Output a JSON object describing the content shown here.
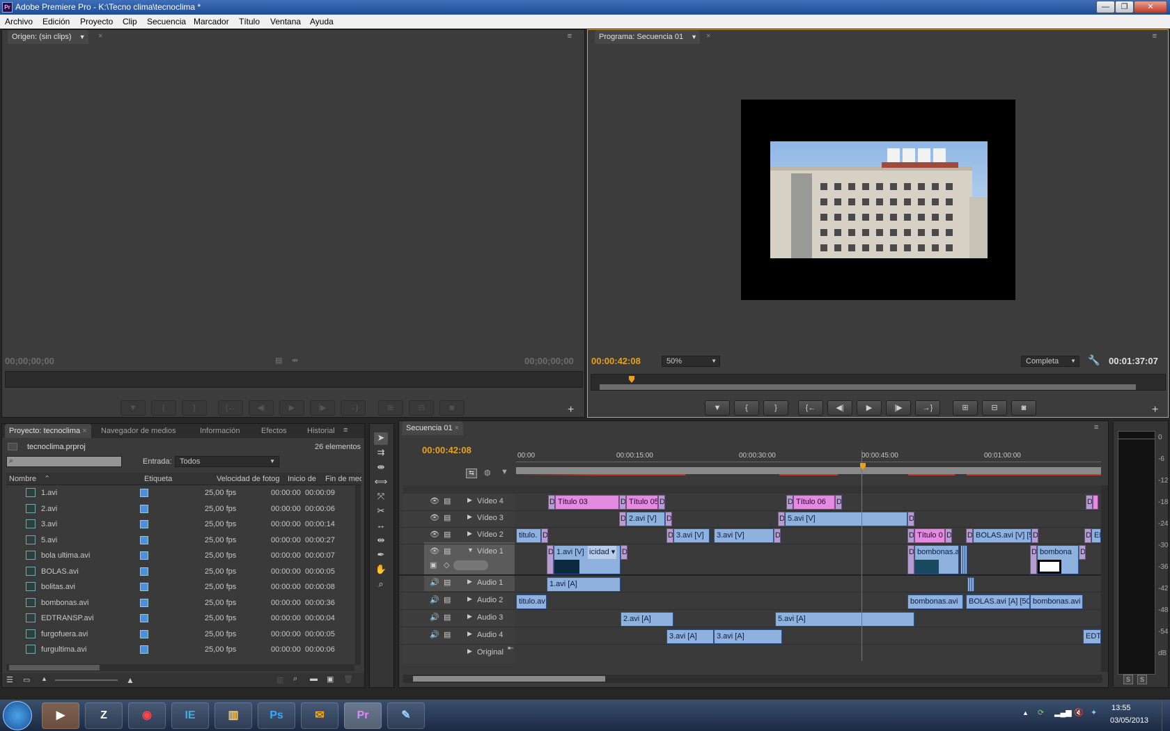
{
  "window": {
    "title": "Adobe Premiere Pro - K:\\Tecno clima\\tecnoclima *",
    "app_icon": "Pr",
    "buttons": {
      "minimize": "—",
      "restore": "❐",
      "close": "✕"
    }
  },
  "menu": [
    "Archivo",
    "Edición",
    "Proyecto",
    "Clip",
    "Secuencia",
    "Marcador",
    "Título",
    "Ventana",
    "Ayuda"
  ],
  "source": {
    "tab": "Origen: (sin clips)",
    "tc_left": "00;00;00;00",
    "tc_right": "00;00;00;00"
  },
  "program": {
    "tab": "Programa: Secuencia 01",
    "timecode": "00:00:42:08",
    "zoom": "50%",
    "quality": "Completa",
    "duration": "00:01:37:07"
  },
  "project": {
    "tabs": [
      "Proyecto: tecnoclima",
      "Navegador de medios",
      "Información",
      "Efectos",
      "Historial"
    ],
    "file": "tecnoclima.prproj",
    "count": "26 elementos",
    "entrada_label": "Entrada:",
    "entrada_value": "Todos",
    "search_placeholder": "",
    "columns": [
      "Nombre",
      "Etiqueta",
      "Velocidad de fotog",
      "Inicio de",
      "Fin de med"
    ],
    "rows": [
      {
        "name": "1.avi",
        "fps": "25,00 fps",
        "start": "00:00:00",
        "end": "00:00:09"
      },
      {
        "name": "2.avi",
        "fps": "25,00 fps",
        "start": "00:00:00",
        "end": "00:00:06"
      },
      {
        "name": "3.avi",
        "fps": "25,00 fps",
        "start": "00:00:00",
        "end": "00:00:14"
      },
      {
        "name": "5.avi",
        "fps": "25,00 fps",
        "start": "00:00:00",
        "end": "00:00:27"
      },
      {
        "name": "bola ultima.avi",
        "fps": "25,00 fps",
        "start": "00:00:00",
        "end": "00:00:07"
      },
      {
        "name": "BOLAS.avi",
        "fps": "25,00 fps",
        "start": "00:00:00",
        "end": "00:00:05"
      },
      {
        "name": "bolitas.avi",
        "fps": "25,00 fps",
        "start": "00:00:00",
        "end": "00:00:08"
      },
      {
        "name": "bombonas.avi",
        "fps": "25,00 fps",
        "start": "00:00:00",
        "end": "00:00:36"
      },
      {
        "name": "EDTRANSP.avi",
        "fps": "25,00 fps",
        "start": "00:00:00",
        "end": "00:00:04"
      },
      {
        "name": "furgofuera.avi",
        "fps": "25,00 fps",
        "start": "00:00:00",
        "end": "00:00:05"
      },
      {
        "name": "furgultima.avi",
        "fps": "25,00 fps",
        "start": "00:00:00",
        "end": "00:00:06"
      }
    ]
  },
  "timeline": {
    "tab": "Secuencia 01",
    "timecode": "00:00:42:08",
    "ruler": [
      "00:00",
      "00:00:15:00",
      "00:00:30:00",
      "00:00:45:00",
      "00:01:00:00"
    ],
    "tracks": [
      "Vídeo 4",
      "Vídeo 3",
      "Vídeo 2",
      "Vídeo 1",
      "Audio 1",
      "Audio 2",
      "Audio 3",
      "Audio 4",
      "Original"
    ],
    "clips": {
      "v4": [
        "Título 03",
        "Título 05",
        "Título 06"
      ],
      "v3": [
        "2.avi [V]",
        "5.avi [V]"
      ],
      "v2": [
        "titulo.",
        "3.avi [V]",
        "3.avi [V]",
        "Título 0",
        "BOLAS.avi [V] [5",
        "EDT"
      ],
      "v1": [
        "1.avi [V]",
        "icidad",
        "bombonas.a",
        "bombona"
      ],
      "a1": [
        "1.avi [A]"
      ],
      "a2": [
        "titulo.av",
        "bombonas.avi",
        "BOLAS.avi [A] [50",
        "bombonas.avi"
      ],
      "a3": [
        "2.avi [A]",
        "5.avi [A]"
      ],
      "a4": [
        "3.avi [A]",
        "3.avi [A]",
        "EDTR"
      ]
    }
  },
  "meter": {
    "scale": [
      "0",
      "-6",
      "-12",
      "-18",
      "-24",
      "-30",
      "-36",
      "-42",
      "-48",
      "-54",
      "dB"
    ],
    "solo": "S"
  },
  "taskbar": {
    "apps": [
      "IE",
      "Ps",
      "Pr"
    ],
    "time": "13:55",
    "date": "03/05/2013"
  },
  "colors": {
    "accent": "#e6a21b",
    "clip_video": "#8eb1de",
    "clip_title": "#e38be0",
    "playhead": "#e84a3a"
  }
}
